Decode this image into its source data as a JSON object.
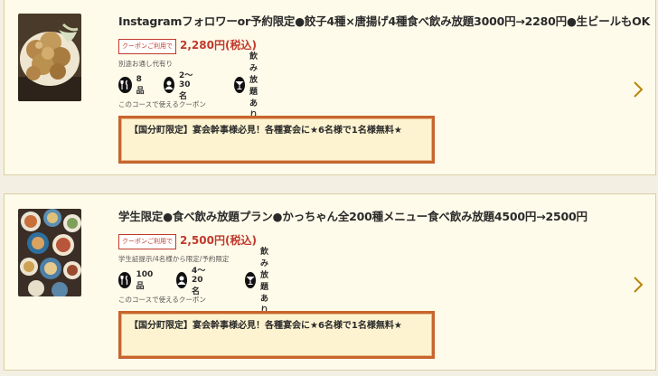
{
  "plans": [
    {
      "title": "Instagramフォロワーor予約限定●餃子4種×唐揚げ4種食べ飲み放題3000円→2280円●生ビールもOK",
      "coupon_badge": "クーポンご利用で",
      "price": "2,280円(税込)",
      "note": "別途お通し代有り",
      "items_count": "8品",
      "people": "2～30名",
      "drink": "飲み放題あり",
      "course_coupon_label": "このコースで使えるクーポン",
      "coupon_text": "【国分町限定】宴会幹事様必見！各種宴会に★6名様で1名様無料★"
    },
    {
      "title": "学生限定●食べ飲み放題プラン●かっちゃん全200種メニュー食べ飲み放題4500円→2500円",
      "coupon_badge": "クーポンご利用で",
      "price": "2,500円(税込)",
      "note": "学生証提示/4名様から限定/予約限定",
      "items_count": "100品",
      "people": "4～20名",
      "drink": "飲み放題あり",
      "course_coupon_label": "このコースで使えるクーポン",
      "coupon_text": "【国分町限定】宴会幹事様必見！各種宴会に★6名様で1名様無料★"
    }
  ],
  "icons": {
    "dishes": "fork-knife-icon",
    "people": "person-icon",
    "drink": "cocktail-glass-icon",
    "chevron": "chevron-right-icon"
  },
  "colors": {
    "price": "#c0392b",
    "coupon_border": "#c7652e",
    "coupon_bg": "#fdf3d0",
    "card_bg": "#fffbea",
    "chevron": "#b8860b"
  }
}
